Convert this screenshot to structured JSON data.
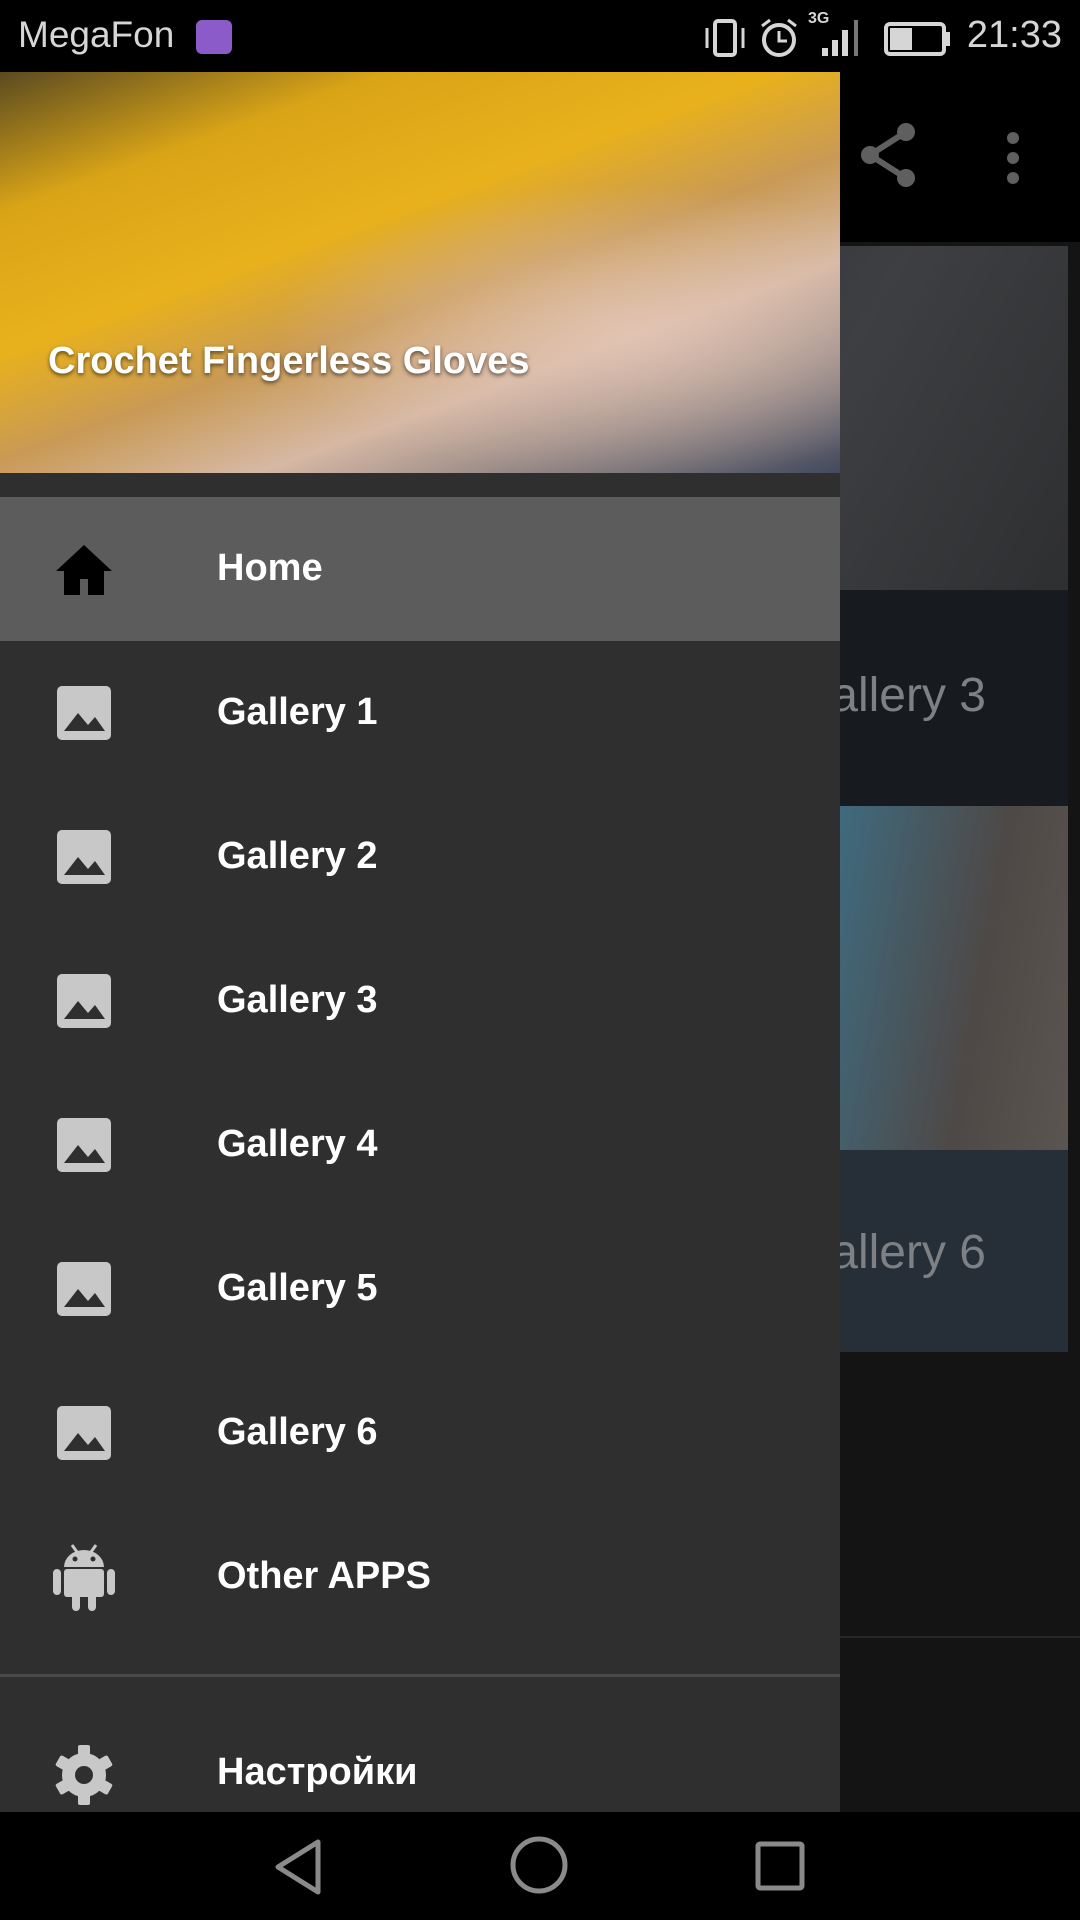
{
  "status_bar": {
    "carrier": "MegaFon",
    "time": "21:33",
    "network": "3G",
    "battery_level": 0.4
  },
  "background": {
    "tiles": [
      {
        "label": "Gallery 3"
      },
      {
        "label": "Gallery 6"
      }
    ]
  },
  "drawer": {
    "header_title": "Crochet Fingerless Gloves",
    "items": [
      {
        "label": "Home",
        "icon": "home-icon",
        "active": true
      },
      {
        "label": "Gallery 1",
        "icon": "image-icon"
      },
      {
        "label": "Gallery 2",
        "icon": "image-icon"
      },
      {
        "label": "Gallery 3",
        "icon": "image-icon"
      },
      {
        "label": "Gallery 4",
        "icon": "image-icon"
      },
      {
        "label": "Gallery 5",
        "icon": "image-icon"
      },
      {
        "label": "Gallery 6",
        "icon": "image-icon"
      },
      {
        "label": "Other APPS",
        "icon": "android-icon"
      }
    ],
    "settings_label": "Настройки"
  }
}
